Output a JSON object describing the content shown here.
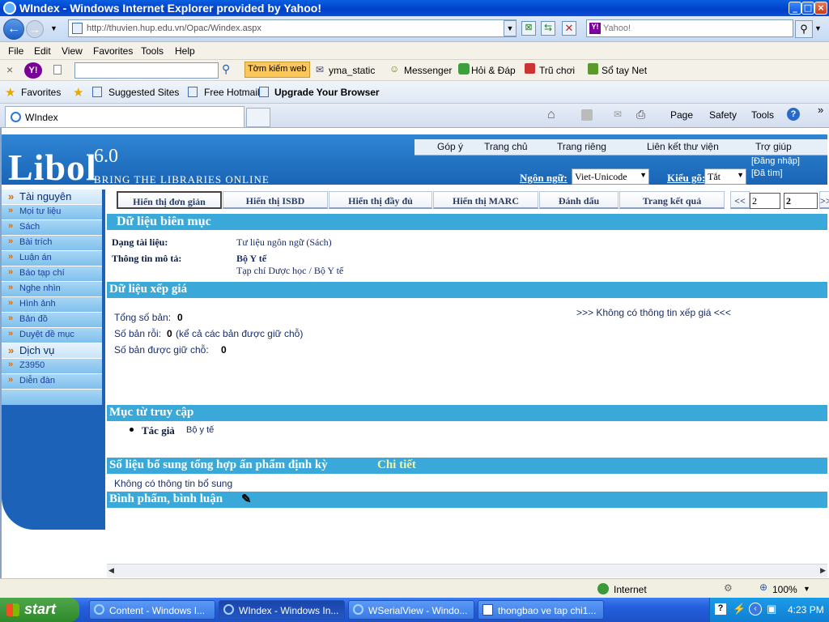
{
  "window": {
    "title": "WIndex - Windows Internet Explorer provided by Yahoo!"
  },
  "nav": {
    "url": "http://thuvien.hup.edu.vn/Opac/Windex.aspx",
    "search_placeholder": "Yahoo!"
  },
  "menu": [
    "File",
    "Edit",
    "View",
    "Favorites",
    "Tools",
    "Help"
  ],
  "yahoo_toolbar": {
    "search_button": "Tờm kiếm web",
    "items": [
      "yma_static",
      "Messenger",
      "Hỏi & Đáp",
      "Trũ chơi",
      "Sổ tay Net"
    ]
  },
  "favorites_bar": {
    "favorites": "Favorites",
    "items": [
      "Suggested Sites",
      "Free Hotmail",
      "Upgrade Your Browser"
    ]
  },
  "tab": {
    "title": "WIndex"
  },
  "command_bar": {
    "page": "Page",
    "safety": "Safety",
    "tools": "Tools"
  },
  "header": {
    "logo": "Libol",
    "version": "6.0",
    "tagline": "BRING THE LIBRARIES ONLINE",
    "top_links": [
      "Góp ý",
      "Trang chủ",
      "Trang riêng",
      "Liên kết thư viện",
      "Trợ giúp"
    ],
    "language_label": "Ngôn ngữ:",
    "language_value": "Viet-Unicode",
    "input_label": "Kiểu gõ:",
    "input_value": "Tắt",
    "login": "[Đăng nhập]",
    "saved": "[Đã tìm]"
  },
  "sidebar": {
    "section1": "Tài nguyên",
    "items1": [
      "Mọi tư liệu",
      "Sách",
      "Bài trích",
      "Luận án",
      "Báo tạp chí",
      "Nghe nhìn",
      "Hình ảnh",
      "Bản đồ",
      "Duyệt đề mục"
    ],
    "section2": "Dịch vụ",
    "items2": [
      "Z3950",
      "Diễn đàn"
    ]
  },
  "view_tabs": [
    "Hiển thị đơn giản",
    "Hiển thị ISBD",
    "Hiển thị đầy đủ",
    "Hiển thị MARC",
    "Đánh dấu",
    "Trang kết quả"
  ],
  "pager": {
    "prev": "<<",
    "current": "2",
    "total": "2",
    "next": ">>"
  },
  "record": {
    "section_title": "Dữ liệu biên mục",
    "type_label": "Dạng tài liệu:",
    "type_value": "Tư liệu ngôn ngữ (Sách)",
    "desc_label": "Thông tin mô tả:",
    "desc_author": "Bộ Y tế",
    "desc_title": "Tạp chí Dược học / Bộ Y tế"
  },
  "holdings": {
    "section_title": "Dữ liệu xếp giá",
    "total_label": "Tổng số bản:",
    "total_value": "0",
    "free_label": "Số bản rỗi:",
    "free_value": "0",
    "free_note": "(kể cả các bản được giữ chỗ)",
    "hold_label": "Số bản được giữ chỗ:",
    "hold_value": "0",
    "no_info": ">>> Không có thông tin xếp giá <<<"
  },
  "access": {
    "section_title": "Mục từ truy cập",
    "author_label": "Tác giả",
    "author_value": "Bộ y tế"
  },
  "serial": {
    "section_title": "Số liệu bổ sung tổng hợp ấn phẩm định kỳ",
    "detail_link": "Chi tiết",
    "no_info": "Không có thông tin bổ sung"
  },
  "review": {
    "section_title": "Bình phẩm, bình luận"
  },
  "status": {
    "zone": "Internet",
    "zoom": "100%"
  },
  "taskbar": {
    "start": "start",
    "tasks": [
      "Content - Windows I...",
      "WIndex - Windows In...",
      "WSerialView - Windo...",
      "thongbao ve tap chi1..."
    ],
    "clock": "4:23 PM"
  },
  "colors": {
    "accent": "#3aa8d8",
    "header_blue": "#1a64b6",
    "sidebar": "#9fd0f2"
  }
}
